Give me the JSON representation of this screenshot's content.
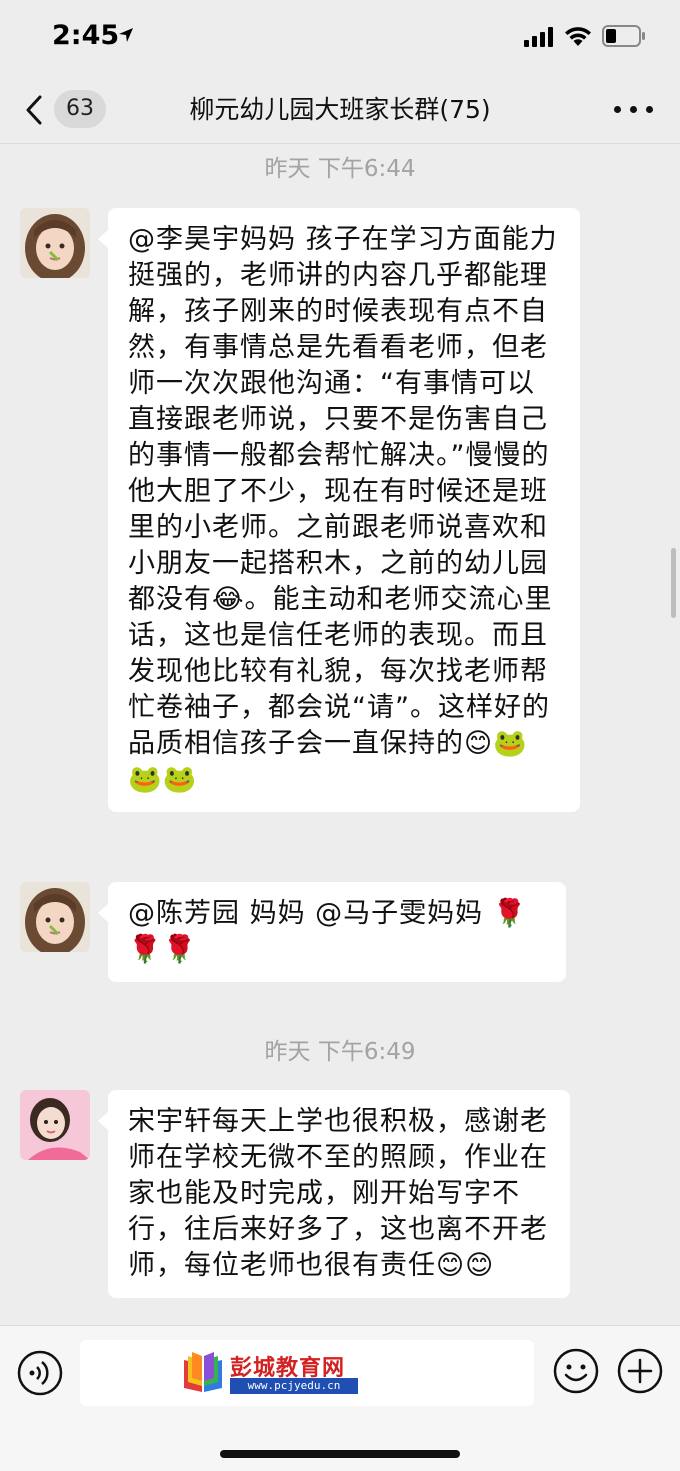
{
  "status_bar": {
    "time": "2:45"
  },
  "nav": {
    "unread_count": "63",
    "title": "柳元幼儿园大班家长群(75)"
  },
  "messages": [
    {
      "type": "timestamp",
      "text": "昨天 下午6:44"
    },
    {
      "type": "message",
      "text": "@李昊宇妈妈 孩子在学习方面能力挺强的，老师讲的内容几乎都能理解，孩子刚来的时候表现有点不自然，有事情总是先看看老师，但老师一次次跟他沟通：“有事情可以直接跟老师说，只要不是伤害自己的事情一般都会帮忙解决。”慢慢的他大胆了不少，现在有时候还是班里的小老师。之前跟老师说喜欢和小朋友一起搭积木，之前的幼儿园都没有😂。能主动和老师交流心里话，这也是信任老师的表现。而且发现他比较有礼貌，每次找老师帮忙卷袖子，都会说“请”。这样好的品质相信孩子会一直保持的😊🐸🐸🐸"
    },
    {
      "type": "message",
      "text": "@陈芳园 妈妈 @马子雯妈妈 🌹🌹🌹"
    },
    {
      "type": "timestamp",
      "text": "昨天 下午6:49"
    },
    {
      "type": "message",
      "text": "宋宇轩每天上学也很积极，感谢老师在学校无微不至的照顾，作业在家也能及时完成，刚开始写字不行，往后来好多了，这也离不开老师，每位老师也很有责任😊😊"
    }
  ],
  "watermark": {
    "name": "彭城教育网",
    "url": "www.pcjyedu.cn"
  }
}
